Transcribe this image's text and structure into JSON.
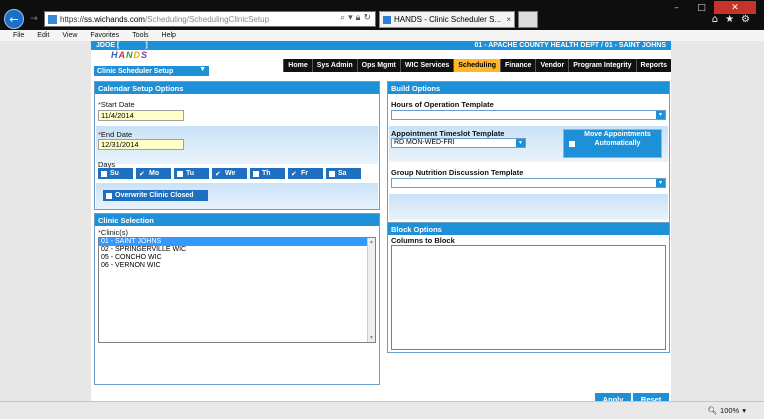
{
  "browser": {
    "address": {
      "protocol": "https://",
      "domain": "ss.wichands.com",
      "path": "/Scheduling/SchedulingClinicSetup"
    },
    "tab_title": "HANDS - Clinic Scheduler S...",
    "tab_close": "×",
    "menu": [
      "File",
      "Edit",
      "View",
      "Favorites",
      "Tools",
      "Help"
    ],
    "zoom": "100%",
    "icons": {
      "back": "arrow-left-icon",
      "forward": "arrow-right-icon",
      "search": "search-icon",
      "refresh": "refresh-icon",
      "home": "home-icon",
      "favorites": "star-icon",
      "settings": "gear-icon"
    }
  },
  "app": {
    "user": "JDOE [",
    "user_suffix": "]",
    "location": "01 - APACHE COUNTY HEALTH DEPT / 01 - SAINT JOHNS",
    "logo_letters": [
      "H",
      "A",
      "N",
      "D",
      "S"
    ],
    "tabs": [
      "Home",
      "Sys Admin",
      "Ops Mgmt",
      "WIC Services",
      "Scheduling",
      "Finance",
      "Vendor",
      "Program Integrity",
      "Reports"
    ],
    "active_tab": "Scheduling",
    "module": "Clinic Scheduler Setup",
    "colors": {
      "header_blue": "#1e90d8",
      "active_tab": "#ffb627",
      "date_field": "#ffffc6",
      "selection": "#3399ff"
    }
  },
  "calendar": {
    "title": "Calendar Setup Options",
    "start_label": "Start Date",
    "start_value": "11/4/2014",
    "end_label": "End Date",
    "end_value": "12/31/2014",
    "days_label": "Days",
    "days": [
      {
        "label": "Su",
        "checked": false
      },
      {
        "label": "Mo",
        "checked": true
      },
      {
        "label": "Tu",
        "checked": false
      },
      {
        "label": "We",
        "checked": true
      },
      {
        "label": "Th",
        "checked": false
      },
      {
        "label": "Fr",
        "checked": true
      },
      {
        "label": "Sa",
        "checked": false
      }
    ],
    "overwrite_label": "Overwrite Clinic Closed"
  },
  "clinic": {
    "title": "Clinic Selection",
    "label": "Clinic(s)",
    "items": [
      "01 - SAINT JOHNS",
      "02 - SPRINGERVILLE WIC",
      "05 - CONCHO WIC",
      "06 - VERNON WIC"
    ],
    "selected_index": 0
  },
  "build": {
    "title": "Build Options",
    "hours_label": "Hours of Operation Template",
    "hours_value": "",
    "timeslot_label": "Appointment Timeslot Template",
    "timeslot_value": "RD MON-WED-FRI",
    "move_label": "Move Appointments Automatically",
    "group_label": "Group Nutrition Discussion Template",
    "group_value": ""
  },
  "block": {
    "title": "Block Options",
    "columns_label": "Columns to Block"
  },
  "actions": {
    "apply": "Apply",
    "reset": "Reset"
  }
}
